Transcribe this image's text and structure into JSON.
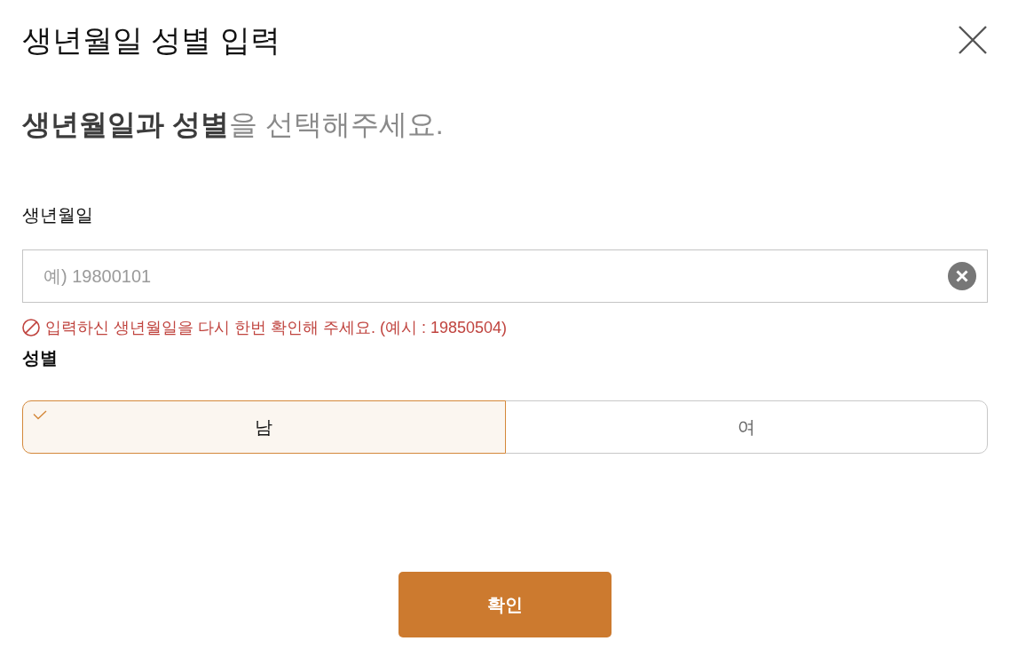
{
  "dialog": {
    "title": "생년월일 성별 입력",
    "heading": "**생년월일과 성별**을 선택해주세요."
  },
  "birthdate": {
    "label": "생년월일",
    "placeholder": "예) 19800101",
    "error": "입력하신 생년월일을 다시 한번 확인해 주세요. (예시 : 19850504)"
  },
  "gender": {
    "label": "성별",
    "options": [
      {
        "label": "남",
        "selected": true
      },
      {
        "label": "여",
        "selected": false
      }
    ]
  },
  "confirm_button": "확인"
}
